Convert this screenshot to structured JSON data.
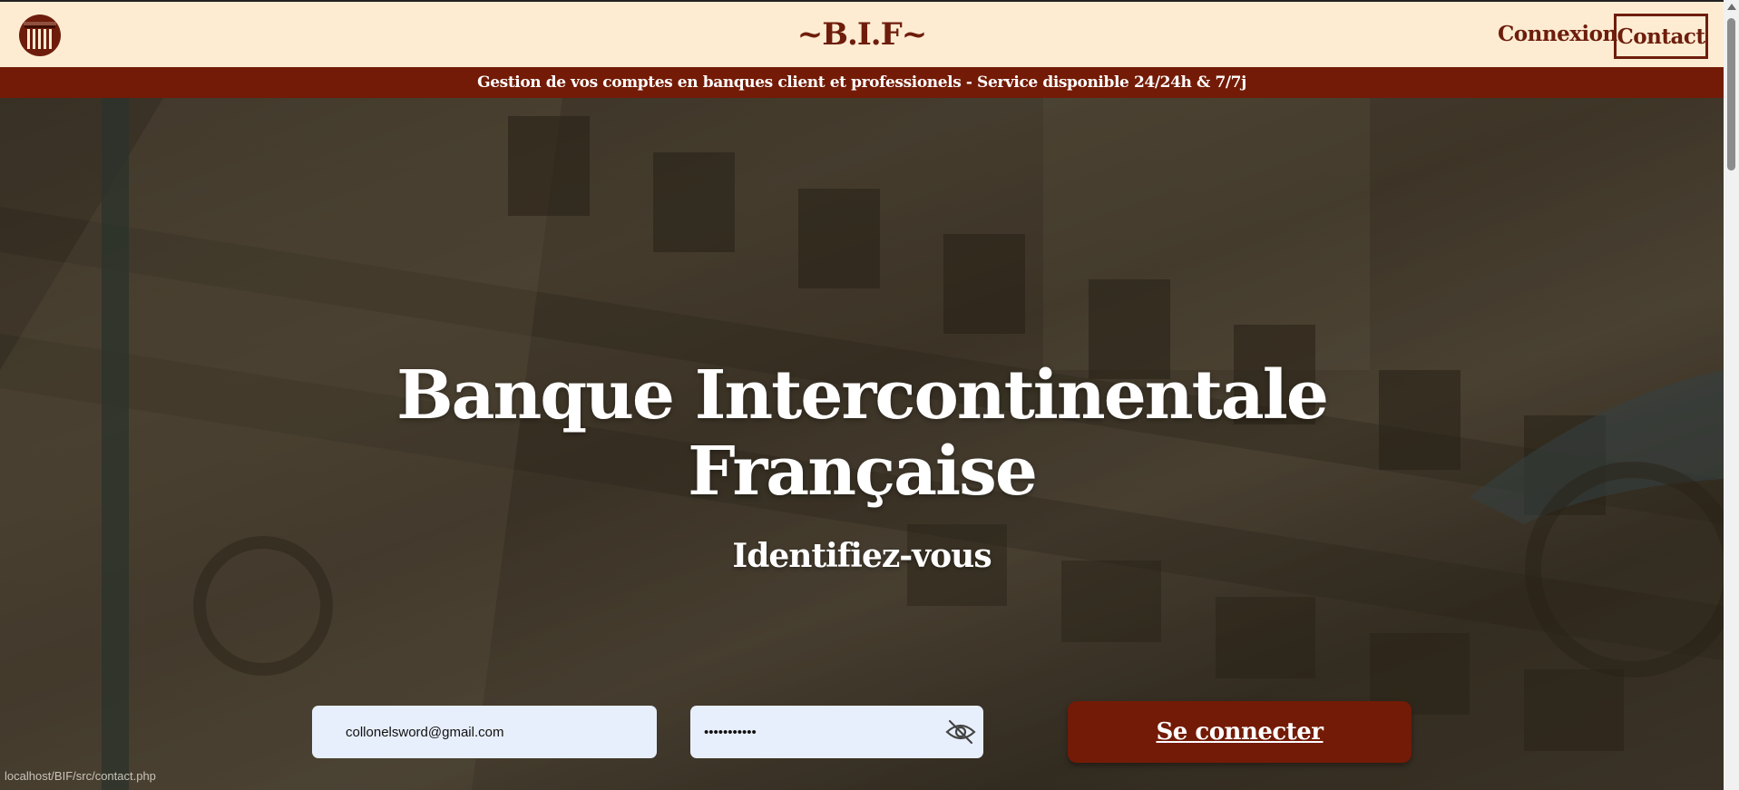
{
  "header": {
    "brand": "~B.I.F~",
    "nav": {
      "connexion": "Connexion",
      "contact": "Contact"
    },
    "logo_icon": "bank-column-icon"
  },
  "banner": {
    "text": "Gestion de vos comptes en banques client et professionels - Service disponible 24/24h & 7/7j"
  },
  "hero": {
    "title_line1": "Banque Intercontinentale",
    "title_line2": "Française"
  },
  "login": {
    "heading": "Identifiez-vous",
    "email_value": "collonelsword@gmail.com",
    "password_value": "•••••••••••",
    "toggle_icon": "eye-slash-icon",
    "submit_label": "Se connecter"
  },
  "status_bar": {
    "url": "localhost/BIF/src/contact.php"
  },
  "colors": {
    "header_bg": "#fdecd2",
    "brand": "#6e1d0c",
    "banner_bg": "#731b06",
    "button_bg": "#731b06",
    "input_bg": "#e8effc"
  }
}
